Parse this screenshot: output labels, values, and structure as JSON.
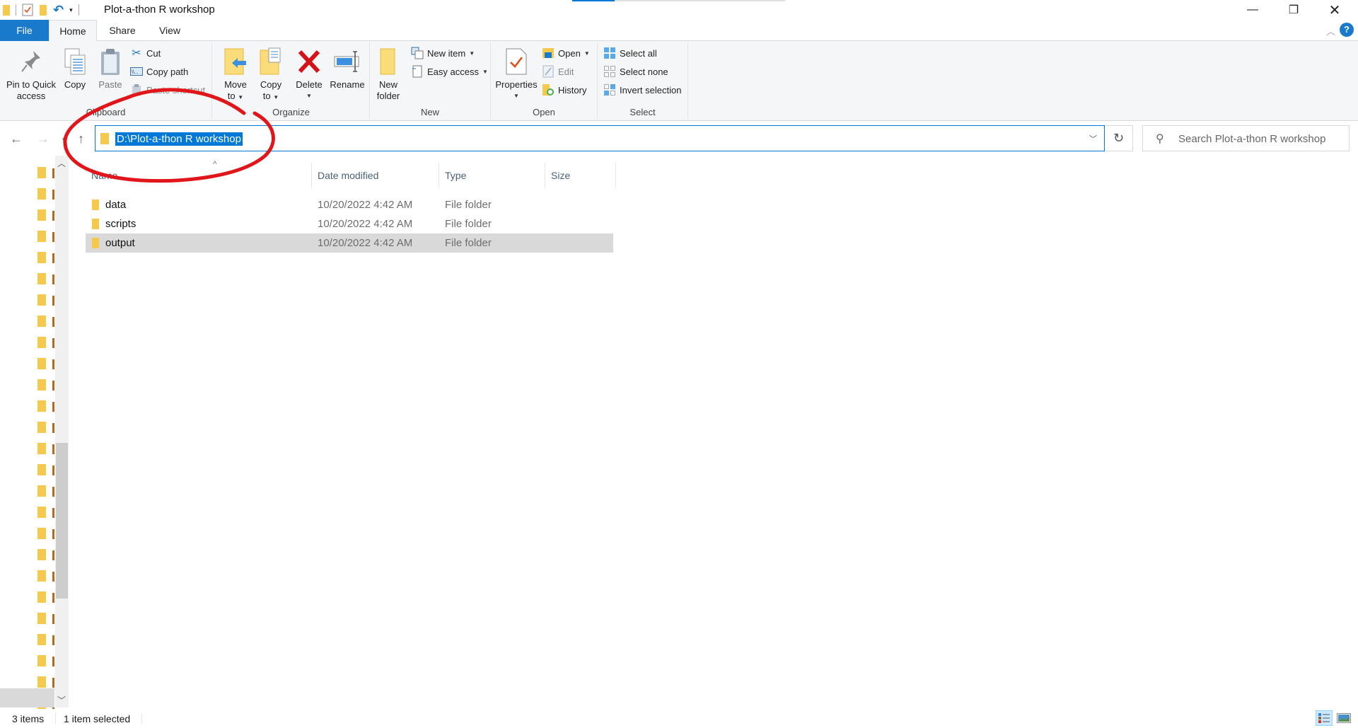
{
  "window": {
    "title": "Plot-a-thon R workshop",
    "controls": {
      "minimize": "—",
      "restore": "❐",
      "close": "✕"
    }
  },
  "tabs": [
    {
      "label": "File"
    },
    {
      "label": "Home"
    },
    {
      "label": "Share"
    },
    {
      "label": "View"
    }
  ],
  "ribbon": {
    "clipboard": {
      "label": "Clipboard",
      "pin": "Pin to Quick access",
      "pin_line1": "Pin to Quick",
      "pin_line2": "access",
      "copy": "Copy",
      "paste": "Paste",
      "cut": "Cut",
      "copy_path": "Copy path",
      "paste_shortcut": "Paste shortcut"
    },
    "organize": {
      "label": "Organize",
      "move_to_1": "Move",
      "move_to_2": "to",
      "copy_to_1": "Copy",
      "copy_to_2": "to",
      "delete": "Delete",
      "rename": "Rename"
    },
    "new": {
      "label": "New",
      "new_folder_1": "New",
      "new_folder_2": "folder",
      "new_item": "New item",
      "easy_access": "Easy access"
    },
    "open": {
      "label": "Open",
      "properties": "Properties",
      "open": "Open",
      "edit": "Edit",
      "history": "History"
    },
    "select": {
      "label": "Select",
      "select_all": "Select all",
      "select_none": "Select none",
      "invert_selection": "Invert selection"
    }
  },
  "navigation": {
    "address": "D:\\Plot-a-thon R workshop",
    "search_placeholder": "Search Plot-a-thon R workshop"
  },
  "columns": {
    "name": "Name",
    "date_modified": "Date modified",
    "type": "Type",
    "size": "Size"
  },
  "files": [
    {
      "name": "data",
      "date_modified": "10/20/2022 4:42 AM",
      "type": "File folder",
      "size": "",
      "selected": false
    },
    {
      "name": "scripts",
      "date_modified": "10/20/2022 4:42 AM",
      "type": "File folder",
      "size": "",
      "selected": false
    },
    {
      "name": "output",
      "date_modified": "10/20/2022 4:42 AM",
      "type": "File folder",
      "size": "",
      "selected": true
    }
  ],
  "status": {
    "item_count": "3 items",
    "selection": "1 item selected"
  },
  "colors": {
    "accent": "#0078d7",
    "file_tab": "#1979ca",
    "selection_row": "#d9d9d9",
    "annotation": "#e0161b"
  }
}
